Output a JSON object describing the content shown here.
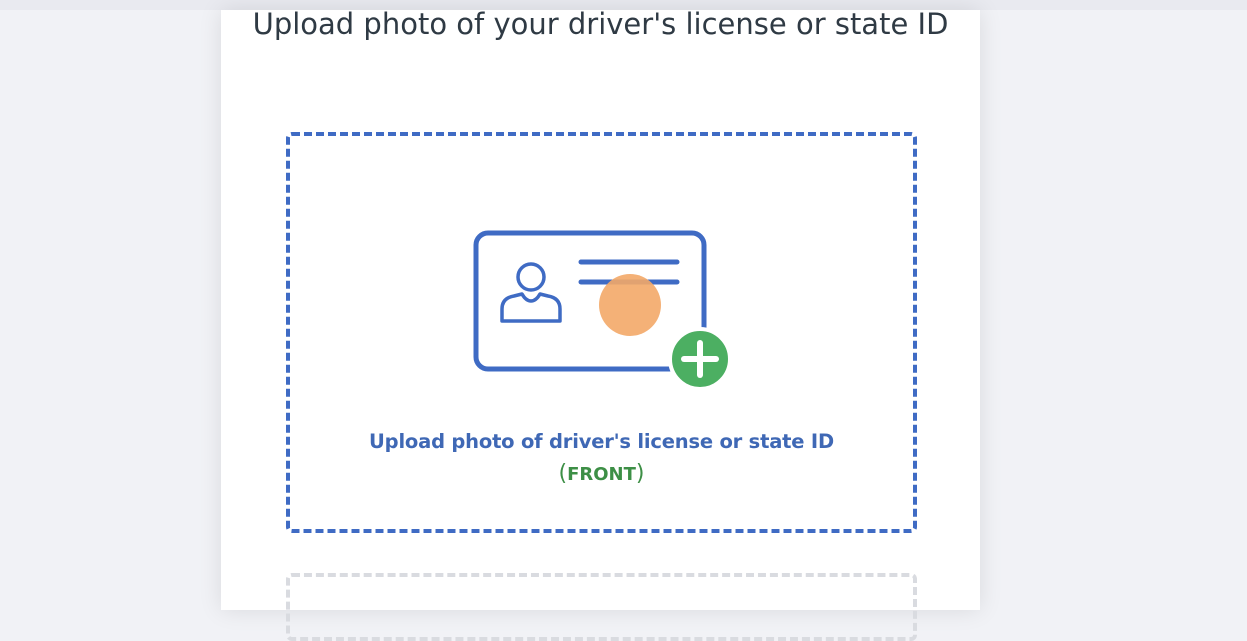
{
  "page": {
    "title": "Upload photo of your driver's license or state ID"
  },
  "front_upload": {
    "label": "Upload photo of driver's license or state ID",
    "side": "FRONT",
    "border_color": "#3f6bc4",
    "icons": [
      "id-card-icon",
      "person-icon",
      "add-circle-icon"
    ]
  },
  "colors": {
    "background": "#f1f2f6",
    "card": "#ffffff",
    "accent_blue": "#3f6bc4",
    "accent_green": "#4caf62",
    "cursor_highlight": "#f3a868"
  }
}
